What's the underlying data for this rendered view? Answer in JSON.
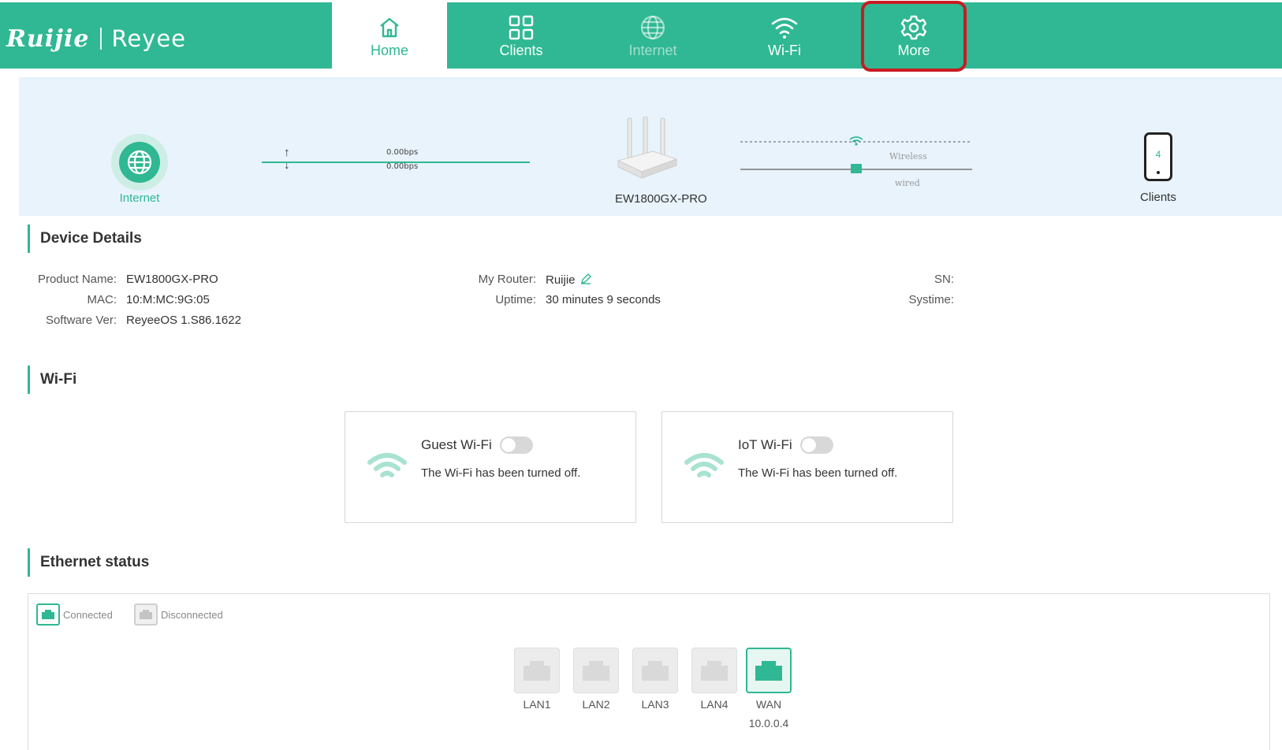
{
  "brand": {
    "left": "Ruijie",
    "right": "Reyee"
  },
  "nav": {
    "home": "Home",
    "clients": "Clients",
    "internet": "Internet",
    "wifi": "Wi-Fi",
    "more": "More"
  },
  "topology": {
    "internet_label": "Internet",
    "upload_rate": "0.00bps",
    "download_rate": "0.00bps",
    "router_model": "EW1800GX-PRO",
    "wireless_label": "Wireless",
    "wired_label": "wired",
    "clients_count": "4",
    "clients_label": "Clients"
  },
  "device_details": {
    "title": "Device Details",
    "product_name_label": "Product Name:",
    "product_name_value": "EW1800GX-PRO",
    "mac_label": "MAC:",
    "mac_value": "10:M:MC:9G:05",
    "software_label": "Software Ver:",
    "software_value": "ReyeeOS 1.S86.1622",
    "my_router_label": "My Router:",
    "my_router_value": "Ruijie",
    "uptime_label": "Uptime:",
    "uptime_value": "30 minutes 9 seconds",
    "sn_label": "SN:",
    "systime_label": "Systime:"
  },
  "wifi": {
    "title": "Wi-Fi",
    "cards": [
      {
        "name": "Guest Wi-Fi",
        "status": "The Wi-Fi has been turned off.",
        "enabled": false
      },
      {
        "name": "IoT Wi-Fi",
        "status": "The Wi-Fi has been turned off.",
        "enabled": false
      }
    ]
  },
  "ethernet": {
    "title": "Ethernet status",
    "legend_connected": "Connected",
    "legend_disconnected": "Disconnected",
    "ports": [
      {
        "name": "LAN1",
        "connected": false
      },
      {
        "name": "LAN2",
        "connected": false
      },
      {
        "name": "LAN3",
        "connected": false
      },
      {
        "name": "LAN4",
        "connected": false
      },
      {
        "name": "WAN",
        "connected": true,
        "ip": "10.0.0.4"
      }
    ]
  },
  "colors": {
    "accent": "#2fb893",
    "highlight_box": "#c81c22",
    "topology_bg": "#e8f3fc"
  }
}
